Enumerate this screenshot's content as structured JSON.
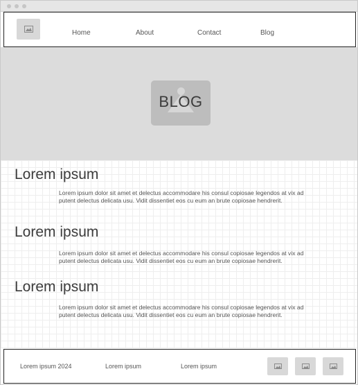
{
  "nav": {
    "items": [
      {
        "label": "Home"
      },
      {
        "label": "About"
      },
      {
        "label": "Contact"
      },
      {
        "label": "Blog"
      }
    ]
  },
  "hero": {
    "label": "BLOG"
  },
  "sections": [
    {
      "title": "Lorem ipsum",
      "body": "Lorem ipsum dolor sit amet et delectus accommodare his consul copiosae legendos at vix ad putent delectus delicata usu. Vidit dissentiet eos cu eum an brute copiosae hendrerit."
    },
    {
      "title": "Lorem ipsum",
      "body": "Lorem ipsum dolor sit amet et delectus accommodare his consul copiosae legendos at vix ad putent delectus delicata usu. Vidit dissentiet eos cu eum an brute copiosae hendrerit."
    },
    {
      "title": "Lorem ipsum",
      "body": "Lorem ipsum dolor sit amet et delectus accommodare his consul copiosae legendos at vix ad putent delectus delicata usu. Vidit dissentiet eos cu eum an brute copiosae hendrerit."
    }
  ],
  "footer": {
    "copyright": "Lorem ipsum 2024",
    "link1": "Lorem ipsum",
    "link2": "Lorem ipsum",
    "icons": [
      "image-icon",
      "image-icon",
      "image-icon"
    ]
  },
  "icons": {
    "logo": "image-icon",
    "hero": "image-placeholder-icon"
  },
  "colors": {
    "placeholder": "#d8d8d8",
    "hero_background": "#dcdcdc",
    "border": "#222222",
    "text": "#555555"
  }
}
